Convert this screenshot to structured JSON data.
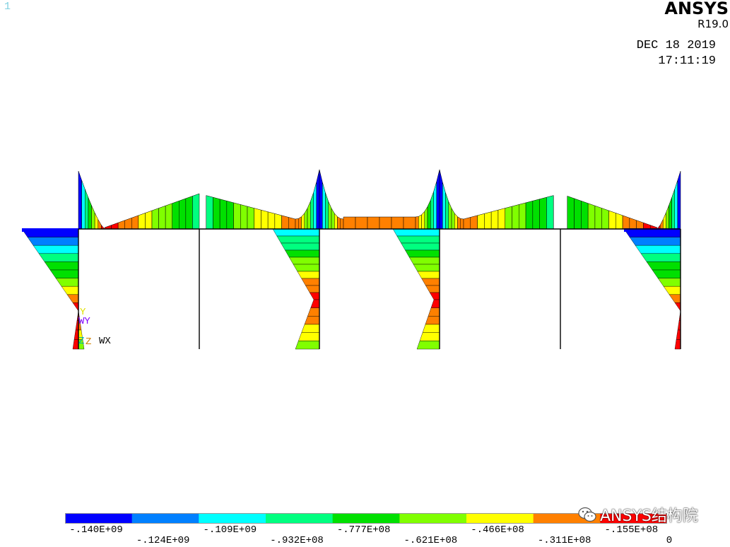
{
  "window": {
    "number": "1",
    "brand": "ANSYS",
    "version": "R19.0",
    "date": "DEC 18 2019",
    "time": "17:11:19"
  },
  "triad": {
    "y": "Y",
    "wy": "WY",
    "z": "Z",
    "wz": "Z",
    "wx": "WX"
  },
  "legend": {
    "colors": [
      "#0000ff",
      "#0080ff",
      "#00ffff",
      "#00ff80",
      "#00e000",
      "#80ff00",
      "#ffff00",
      "#ff8000",
      "#ff0000"
    ],
    "labels_upper": [
      "-.140E+09",
      "-.109E+09",
      "-.777E+08",
      "-.466E+08",
      "-.155E+08"
    ],
    "labels_lower": [
      "-.124E+09",
      "-.932E+08",
      "-.621E+08",
      "-.311E+08",
      "0"
    ]
  },
  "watermark": {
    "text": "ANSYS结构院",
    "icon": "wechat-icon"
  }
}
